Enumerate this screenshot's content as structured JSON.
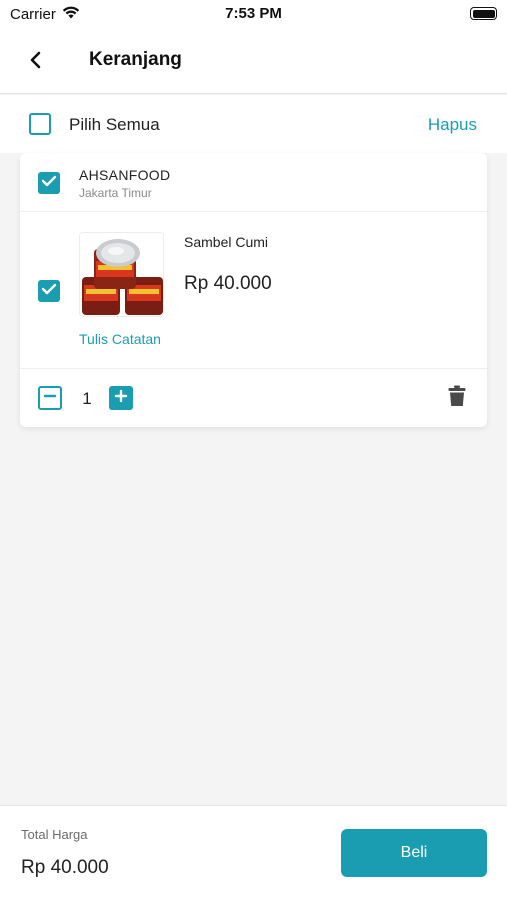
{
  "status_bar": {
    "carrier": "Carrier",
    "time": "7:53 PM"
  },
  "header": {
    "title": "Keranjang",
    "back_icon": "chevron-left-icon"
  },
  "select_bar": {
    "select_all_label": "Pilih Semua",
    "delete_label": "Hapus",
    "select_all_checked": false
  },
  "cart": {
    "store": {
      "name": "AHSANFOOD",
      "location": "Jakarta Timur",
      "checked": true
    },
    "items": [
      {
        "name": "Sambel Cumi",
        "price": "Rp 40.000",
        "note_label": "Tulis Catatan",
        "quantity": "1",
        "checked": true
      }
    ]
  },
  "footer": {
    "total_label": "Total Harga",
    "total_value": "Rp 40.000",
    "buy_label": "Beli"
  },
  "colors": {
    "accent": "#1a9db1",
    "background": "#f4f4f4"
  }
}
